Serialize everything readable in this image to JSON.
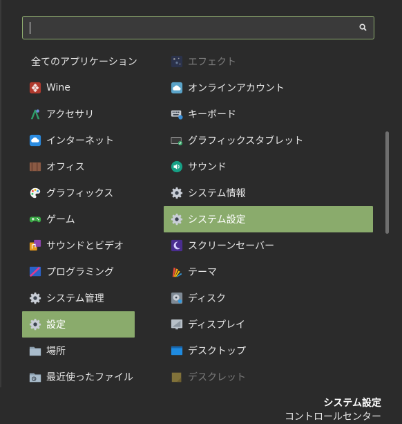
{
  "search": {
    "value": "",
    "placeholder": ""
  },
  "categories": [
    {
      "label": "全てのアプリケーション",
      "icon": ""
    },
    {
      "label": "Wine",
      "icon": "wine-icon"
    },
    {
      "label": "アクセサリ",
      "icon": "accessories-icon"
    },
    {
      "label": "インターネット",
      "icon": "internet-cloud-icon"
    },
    {
      "label": "オフィス",
      "icon": "office-icon"
    },
    {
      "label": "グラフィックス",
      "icon": "palette-icon"
    },
    {
      "label": "ゲーム",
      "icon": "gamepad-icon"
    },
    {
      "label": "サウンドとビデオ",
      "icon": "music-video-icon"
    },
    {
      "label": "プログラミング",
      "icon": "programming-icon"
    },
    {
      "label": "システム管理",
      "icon": "gear-icon"
    },
    {
      "label": "設定",
      "icon": "gear-icon",
      "selected": true
    },
    {
      "label": "場所",
      "icon": "folder-icon"
    },
    {
      "label": "最近使ったファイル",
      "icon": "recent-files-icon"
    }
  ],
  "apps": [
    {
      "label": "エフェクト",
      "icon": "effects-icon",
      "dim": true
    },
    {
      "label": "オンラインアカウント",
      "icon": "online-accounts-icon"
    },
    {
      "label": "キーボード",
      "icon": "keyboard-icon"
    },
    {
      "label": "グラフィックスタブレット",
      "icon": "tablet-icon"
    },
    {
      "label": "サウンド",
      "icon": "sound-icon"
    },
    {
      "label": "システム情報",
      "icon": "gear-icon"
    },
    {
      "label": "システム設定",
      "icon": "gear-icon",
      "selected": true
    },
    {
      "label": "スクリーンセーバー",
      "icon": "screensaver-icon"
    },
    {
      "label": "テーマ",
      "icon": "theme-icon"
    },
    {
      "label": "ディスク",
      "icon": "disk-icon"
    },
    {
      "label": "ディスプレイ",
      "icon": "display-icon"
    },
    {
      "label": "デスクトップ",
      "icon": "desktop-icon"
    },
    {
      "label": "デスクレット",
      "icon": "desklet-icon",
      "dim": true
    }
  ],
  "footer": {
    "title": "システム設定",
    "subtitle": "コントロールセンター"
  },
  "colors": {
    "accent": "#8aab6c",
    "background": "#2b2b2b",
    "search_border": "#8fae6f"
  }
}
